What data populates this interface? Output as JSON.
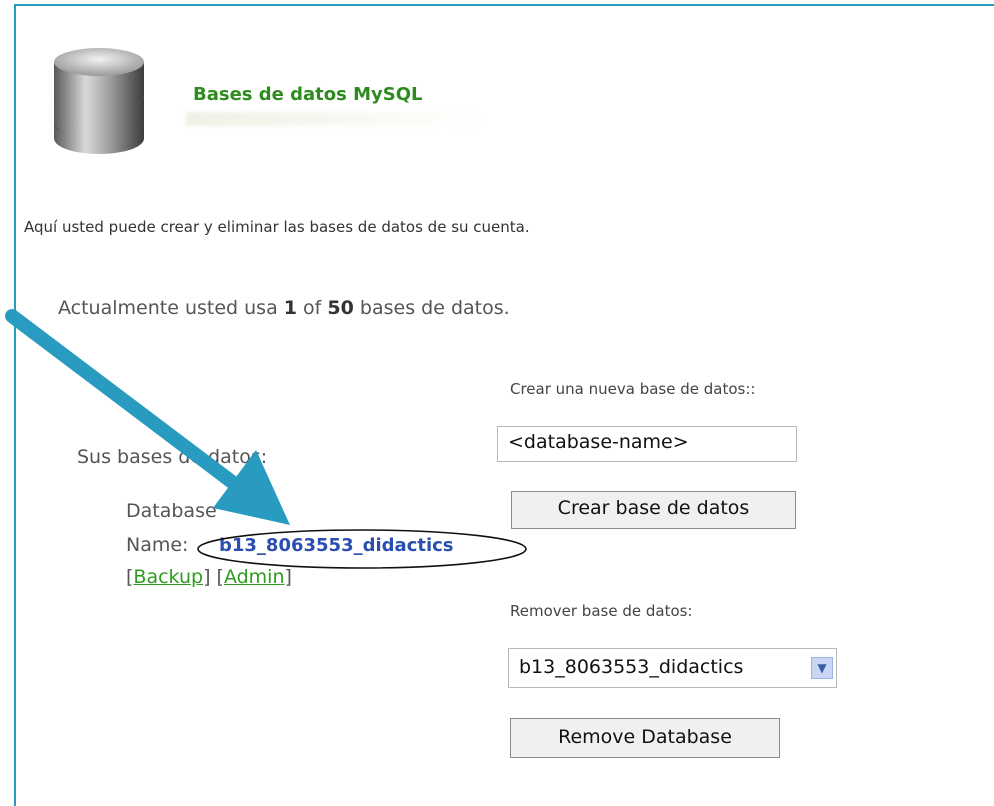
{
  "header": {
    "title": "Bases de datos MySQL",
    "icon": "database-icon"
  },
  "description": "Aquí usted puede crear y eliminar las bases de datos de su cuenta.",
  "usage": {
    "prefix": "Actualmente usted usa",
    "used": "1",
    "of": "of",
    "total": "50",
    "suffix": "bases de datos."
  },
  "create": {
    "label": "Crear una nueva base de datos::",
    "input_value": "<database-name>",
    "button": "Crear base de datos"
  },
  "list": {
    "heading": "Sus bases de datos:",
    "db_label_line1": "Database",
    "db_label_line2": "Name:",
    "db_name": "b13_8063553_didactics",
    "backup_link": "Backup",
    "admin_link": "Admin"
  },
  "remove": {
    "label": "Remover base de datos:",
    "selected": "b13_8063553_didactics",
    "button": "Remove Database"
  },
  "colors": {
    "accent": "#2a9bc0",
    "title_green": "#2e8b1e",
    "link_green": "#2e9c1e",
    "db_name_blue": "#2a4fb0"
  }
}
